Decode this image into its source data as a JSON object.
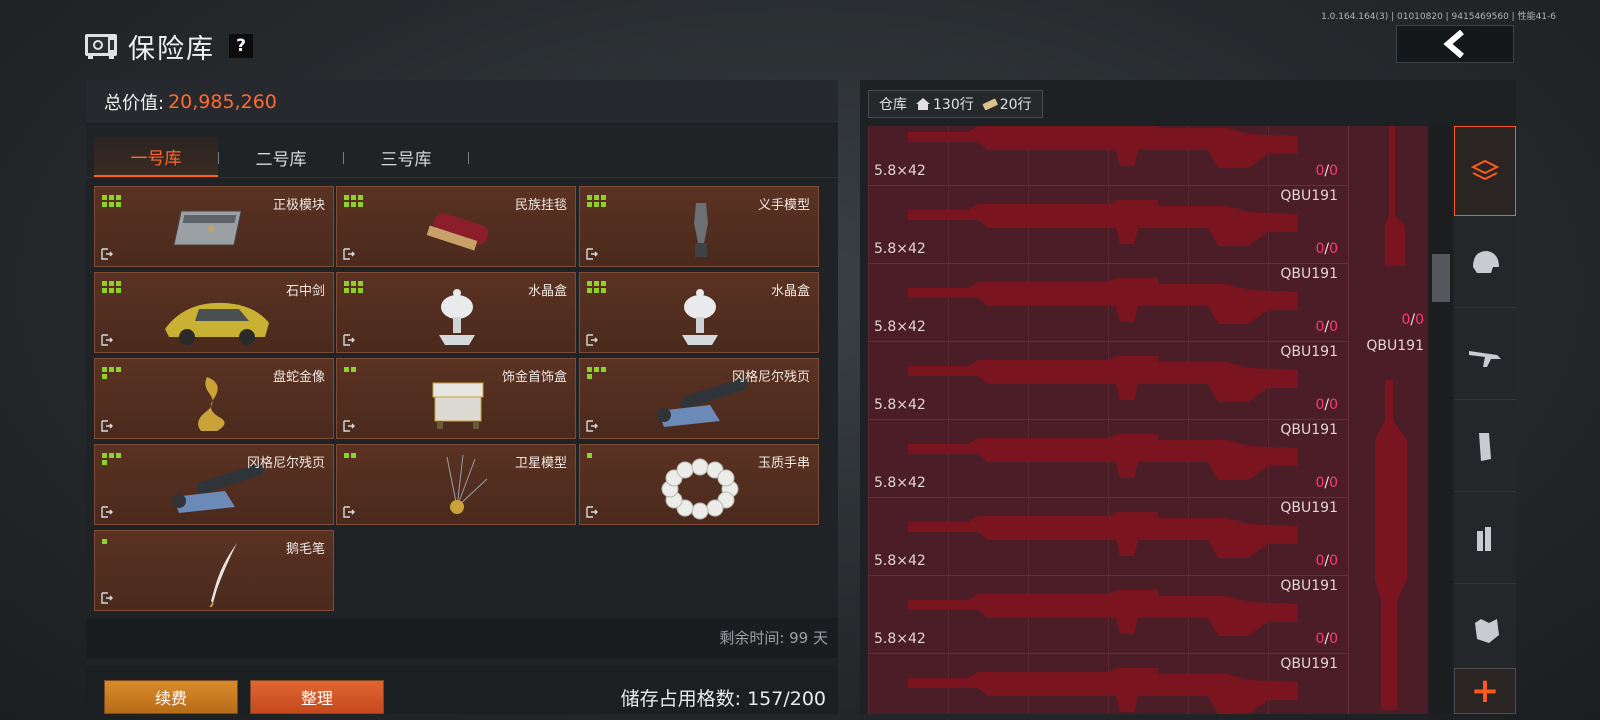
{
  "version": "1.0.164.164(3) | 01010820 | 9415469560 | 性能41-6",
  "header": {
    "title": "保险库",
    "help": "?"
  },
  "vault": {
    "total_label": "总价值:",
    "total_value": "20,985,260",
    "tabs": [
      "一号库",
      "二号库",
      "三号库"
    ],
    "active_tab": 0,
    "items": [
      {
        "name": "正极模块",
        "icon": "module-icon",
        "size": 6
      },
      {
        "name": "民族挂毯",
        "icon": "tapestry-icon",
        "size": 6
      },
      {
        "name": "义手模型",
        "icon": "prosthetic-hand-icon",
        "size": 6
      },
      {
        "name": "石中剑",
        "icon": "sports-car-icon",
        "size": 6
      },
      {
        "name": "水晶盒",
        "icon": "crystal-box-icon",
        "size": 6
      },
      {
        "name": "水晶盒",
        "icon": "crystal-box-icon",
        "size": 6
      },
      {
        "name": "盘蛇金像",
        "icon": "golden-snake-icon",
        "size": 4
      },
      {
        "name": "饰金首饰盒",
        "icon": "jewelry-box-icon",
        "size": 2
      },
      {
        "name": "冈格尼尔残页",
        "icon": "scroll-icon",
        "size": 4
      },
      {
        "name": "冈格尼尔残页",
        "icon": "scroll-icon",
        "size": 4
      },
      {
        "name": "卫星模型",
        "icon": "satellite-icon",
        "size": 2
      },
      {
        "name": "玉质手串",
        "icon": "bracelet-icon",
        "size": 1
      },
      {
        "name": "鹅毛笔",
        "icon": "quill-icon",
        "size": 1
      }
    ],
    "remain_time": "剩余时间: 99 天",
    "renew_btn": "续费",
    "sort_btn": "整理",
    "usage": "储存占用格数: 157/200"
  },
  "warehouse": {
    "label": "仓库",
    "rows_a": "130行",
    "rows_b": "20行",
    "weapons": [
      {
        "caliber": "5.8×42",
        "model": "",
        "ammo_current": "0",
        "ammo_max": "0"
      },
      {
        "caliber": "5.8×42",
        "model": "QBU191",
        "ammo_current": "0",
        "ammo_max": "0"
      },
      {
        "caliber": "5.8×42",
        "model": "QBU191",
        "ammo_current": "0",
        "ammo_max": "0"
      },
      {
        "caliber": "5.8×42",
        "model": "QBU191",
        "ammo_current": "0",
        "ammo_max": "0"
      },
      {
        "caliber": "5.8×42",
        "model": "QBU191",
        "ammo_current": "0",
        "ammo_max": "0"
      },
      {
        "caliber": "5.8×42",
        "model": "QBU191",
        "ammo_current": "0",
        "ammo_max": "0"
      },
      {
        "caliber": "5.8×42",
        "model": "QBU191",
        "ammo_current": "0",
        "ammo_max": "0"
      },
      {
        "caliber": "",
        "model": "QBU191",
        "ammo_current": "",
        "ammo_max": ""
      }
    ],
    "side_weapon": {
      "model": "QBU191",
      "ammo_current": "0",
      "ammo_max": "0"
    },
    "categories": [
      "all-items-icon",
      "helmet-icon",
      "rifle-icon",
      "magazine-icon",
      "ammo-icon",
      "armor-icon"
    ]
  },
  "colors": {
    "accent": "#ff5a1e",
    "ammo_red": "#ff3a6e",
    "slot_bg": "#5a3222",
    "weapon_bg": "#4a1d27"
  }
}
